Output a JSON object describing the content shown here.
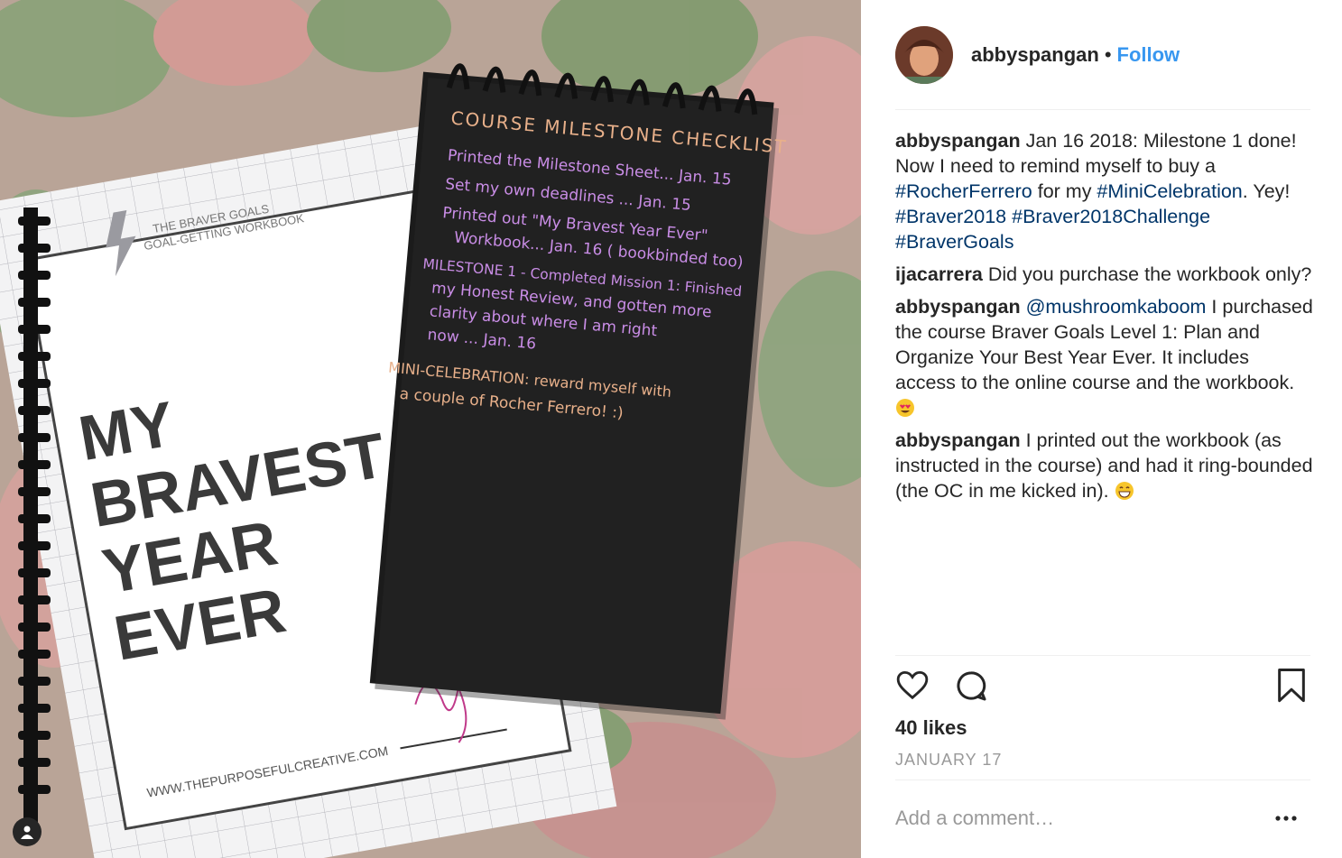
{
  "post": {
    "username": "abbyspangan",
    "separator": "•",
    "follow_label": "Follow",
    "likes": "40 likes",
    "date": "JANUARY 17",
    "add_comment_placeholder": "Add a comment…"
  },
  "photo": {
    "workbook": {
      "subtitle_1": "THE BRAVER GOALS",
      "subtitle_2": "GOAL-GETTING WORKBOOK",
      "title_lines": [
        "MY",
        "BRAVEST",
        "YEAR",
        "EVER"
      ],
      "website": "WWW.THEPURPOSEFULCREATIVE.COM"
    },
    "notebook": {
      "heading": "COURSE MILESTONE CHECKLIST",
      "lines": [
        "Printed the Milestone Sheet... Jan. 15",
        "Set my own deadlines ... Jan. 15",
        "Printed out \"My Bravest Year Ever\"",
        "Workbook... Jan. 16 ( bookbinded too)",
        "MILESTONE 1 - Completed Mission 1: Finished",
        "my Honest Review, and gotten more",
        "clarity about where I am right",
        "now ... Jan. 16",
        "MINI-CELEBRATION: reward myself with",
        "a couple of Rocher Ferrero! :)"
      ]
    }
  },
  "comments": [
    {
      "user": "abbyspangan",
      "parts": [
        {
          "t": " Jan 16 2018: Milestone 1 done! Now I need to remind myself to buy a "
        },
        {
          "t": "#RocherFerrero",
          "tag": true
        },
        {
          "t": " for my "
        },
        {
          "t": "#MiniCelebration",
          "tag": true
        },
        {
          "t": ". Yey! "
        },
        {
          "t": "#Braver2018",
          "tag": true
        },
        {
          "t": " "
        },
        {
          "t": "#Braver2018Challenge",
          "tag": true
        },
        {
          "t": " "
        },
        {
          "t": "#BraverGoals",
          "tag": true
        }
      ]
    },
    {
      "user": "ijacarrera",
      "parts": [
        {
          "t": " Did you purchase the workbook only?"
        }
      ]
    },
    {
      "user": "abbyspangan",
      "parts": [
        {
          "t": " "
        },
        {
          "t": "@mushroomkaboom",
          "tag": true
        },
        {
          "t": " I purchased the course Braver Goals Level 1: Plan and Organize Your Best Year Ever. It includes access to the online course and the workbook. "
        },
        {
          "emoji": "heart-eyes"
        }
      ]
    },
    {
      "user": "abbyspangan",
      "parts": [
        {
          "t": " I printed out the workbook (as instructed in the course) and had it ring-bounded (the OC in me kicked in). "
        },
        {
          "emoji": "grin"
        }
      ]
    }
  ],
  "icons": {
    "like": "heart-icon",
    "comment": "comment-icon",
    "save": "bookmark-icon",
    "more": "more-icon",
    "user_tag": "user-icon"
  },
  "colors": {
    "link": "#3897f0",
    "hashtag": "#003569",
    "muted": "#999999",
    "text": "#262626"
  }
}
